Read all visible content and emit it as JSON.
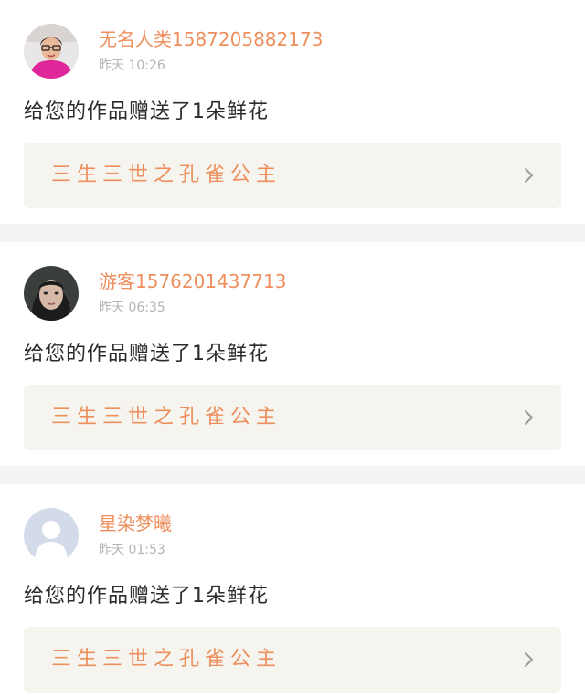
{
  "notifications": [
    {
      "user_name": "无名人类15872058821​73",
      "time": "昨天 10:26",
      "avatar": "person-photo-avatar-pink",
      "message": "给您的作品赠送了1朵鲜花",
      "work_title": "三生三世之孔雀公主",
      "chevron_icon": "chevron-right-icon"
    },
    {
      "user_name": "游客15762014377​13",
      "time": "昨天 06:35",
      "avatar": "person-photo-avatar-face",
      "message": "给您的作品赠送了1朵鲜花",
      "work_title": "三生三世之孔雀公主",
      "chevron_icon": "chevron-right-icon"
    },
    {
      "user_name": "星染梦曦",
      "time": "昨天 01:53",
      "avatar": "default-user-avatar",
      "message": "给您的作品赠送了1朵鲜花",
      "work_title": "三生三世之孔雀公主",
      "chevron_icon": "chevron-right-icon"
    }
  ],
  "colors": {
    "accent": "#ee8f5e",
    "link_background": "#f5f4ef",
    "separator": "#f5f2f2",
    "time_text": "#b4b4b4",
    "message_text": "#2b2b2b"
  }
}
